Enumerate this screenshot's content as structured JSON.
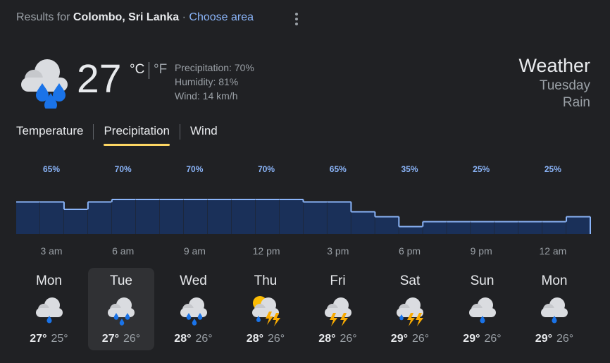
{
  "header": {
    "prefix": "Results for",
    "location": "Colombo, Sri Lanka",
    "separator": "·",
    "choose_area": "Choose area"
  },
  "current": {
    "icon": "rain-cloud-icon",
    "temperature": "27",
    "unit_c": "°C",
    "unit_f": "°F",
    "precipitation": "Precipitation: 70%",
    "humidity": "Humidity: 81%",
    "wind": "Wind: 14 km/h"
  },
  "summary": {
    "title": "Weather",
    "day": "Tuesday",
    "condition": "Rain"
  },
  "tabs": [
    {
      "label": "Temperature",
      "active": false
    },
    {
      "label": "Precipitation",
      "active": true
    },
    {
      "label": "Wind",
      "active": false
    }
  ],
  "chart_data": {
    "type": "area",
    "label_values": [
      "65%",
      "70%",
      "70%",
      "70%",
      "65%",
      "35%",
      "25%",
      "25%"
    ],
    "x_labels": [
      "3 am",
      "6 am",
      "9 am",
      "12 pm",
      "3 pm",
      "6 pm",
      "9 pm",
      "12 am"
    ],
    "values": [
      65,
      65,
      50,
      65,
      70,
      70,
      70,
      70,
      70,
      70,
      70,
      70,
      65,
      65,
      45,
      35,
      15,
      25,
      25,
      25,
      25,
      25,
      25,
      35
    ],
    "ylim": [
      0,
      100
    ],
    "fill_color": "#1a3059",
    "line_color": "#8ab4f8",
    "label_color": "#8ab4f8"
  },
  "forecast": [
    {
      "day": "Mon",
      "icon": "rain-cloud-icon",
      "hi": "27°",
      "lo": "25°",
      "selected": false
    },
    {
      "day": "Tue",
      "icon": "heavy-rain-cloud-icon",
      "hi": "27°",
      "lo": "26°",
      "selected": true
    },
    {
      "day": "Wed",
      "icon": "heavy-rain-cloud-icon",
      "hi": "28°",
      "lo": "26°",
      "selected": false
    },
    {
      "day": "Thu",
      "icon": "sun-thunderstorm-icon",
      "hi": "28°",
      "lo": "26°",
      "selected": false
    },
    {
      "day": "Fri",
      "icon": "thunderstorm-icon",
      "hi": "28°",
      "lo": "26°",
      "selected": false
    },
    {
      "day": "Sat",
      "icon": "thunderstorm-rain-icon",
      "hi": "29°",
      "lo": "26°",
      "selected": false
    },
    {
      "day": "Sun",
      "icon": "rain-cloud-icon",
      "hi": "29°",
      "lo": "26°",
      "selected": false
    },
    {
      "day": "Mon",
      "icon": "rain-cloud-icon",
      "hi": "29°",
      "lo": "26°",
      "selected": false
    }
  ]
}
